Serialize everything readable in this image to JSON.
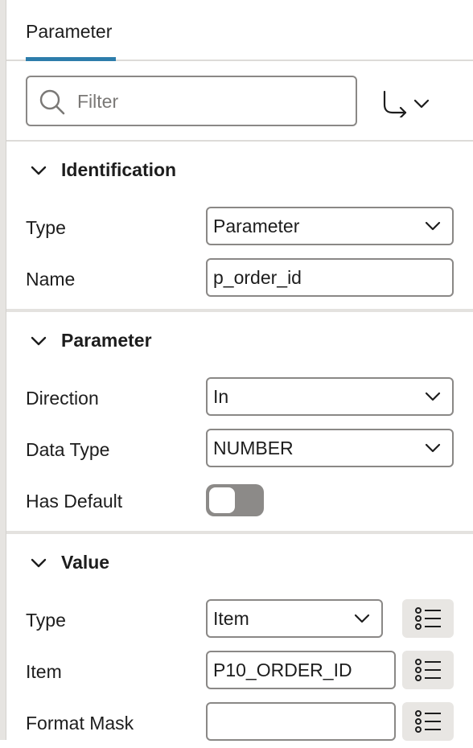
{
  "tabs": [
    {
      "label": "Parameter",
      "active": true
    }
  ],
  "filter": {
    "placeholder": "Filter",
    "value": ""
  },
  "sections": {
    "identification": {
      "title": "Identification",
      "type_label": "Type",
      "type_value": "Parameter",
      "name_label": "Name",
      "name_value": "p_order_id"
    },
    "parameter": {
      "title": "Parameter",
      "direction_label": "Direction",
      "direction_value": "In",
      "data_type_label": "Data Type",
      "data_type_value": "NUMBER",
      "has_default_label": "Has Default",
      "has_default_on": false
    },
    "value": {
      "title": "Value",
      "type_label": "Type",
      "type_value": "Item",
      "item_label": "Item",
      "item_value": "P10_ORDER_ID",
      "format_mask_label": "Format Mask",
      "format_mask_value": ""
    }
  },
  "icons": {
    "search": "search-icon",
    "goto": "goto-arrow-icon",
    "collapse": "chevron-down-icon",
    "list": "list-icon"
  },
  "colors": {
    "accent": "#2d7dab",
    "toggle_off": "#8c8a88",
    "border": "#8a8886"
  }
}
